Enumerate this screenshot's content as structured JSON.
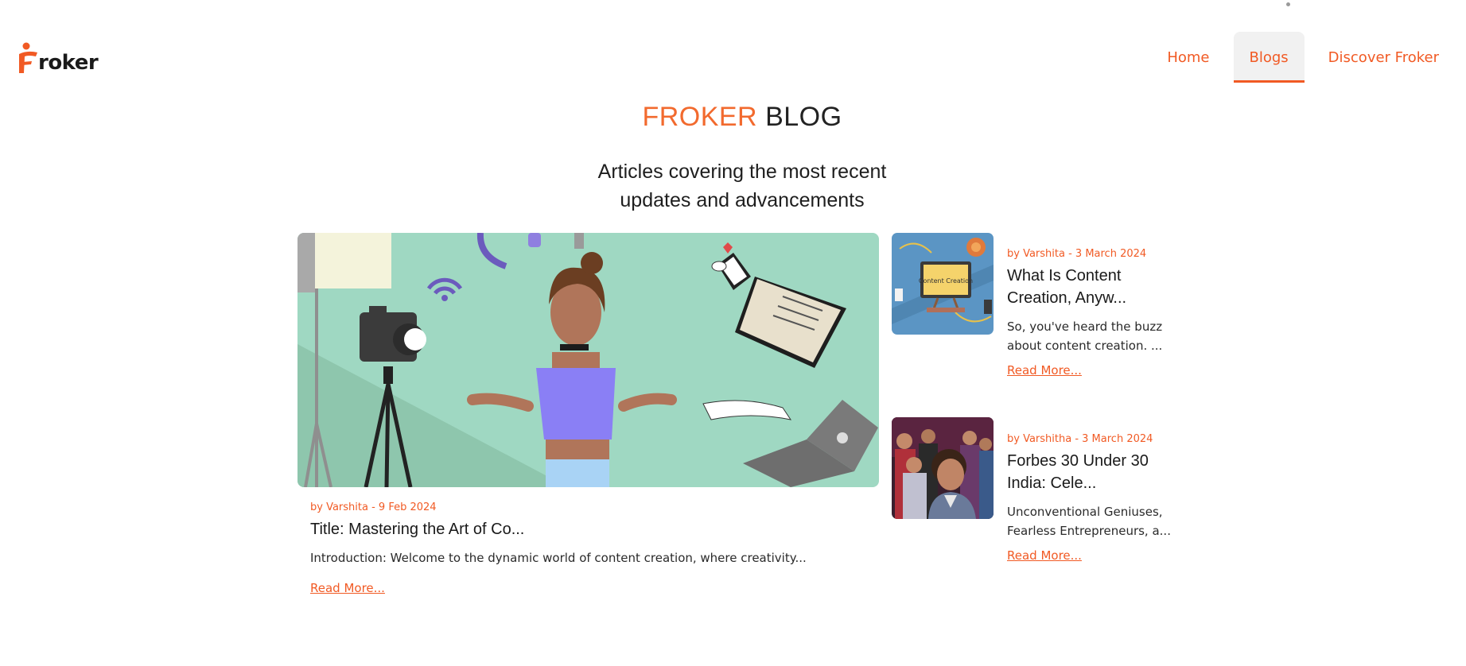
{
  "brand": {
    "logo_text": "roker",
    "accent": "#f15a24"
  },
  "nav": {
    "items": [
      {
        "label": "Home"
      },
      {
        "label": "Blogs"
      },
      {
        "label": "Discover Froker"
      }
    ],
    "active": "Blogs"
  },
  "hero": {
    "title_accent": "FROKER",
    "title_rest": "BLOG",
    "subtitle_line1": "Articles covering the most recent",
    "subtitle_line2": "updates and advancements"
  },
  "featured": {
    "meta": "by Varshita - 9 Feb 2024",
    "title": "Title: Mastering the Art of Co...",
    "excerpt": "Introduction: Welcome to the dynamic world of content creation, where creativity...",
    "read_more": "Read More..."
  },
  "side_posts": [
    {
      "meta": "by Varshita - 3 March 2024",
      "title": "What Is Content Creation, Anyw...",
      "excerpt": "So, you've heard the buzz about content creation. ...",
      "read_more": "Read More...",
      "image_text": "Content Creation"
    },
    {
      "meta": "by Varshitha - 3 March 2024",
      "title": "Forbes 30 Under 30 India: Cele...",
      "excerpt": "Unconventional Geniuses, Fearless Entrepreneurs, a...",
      "read_more": "Read More..."
    }
  ]
}
